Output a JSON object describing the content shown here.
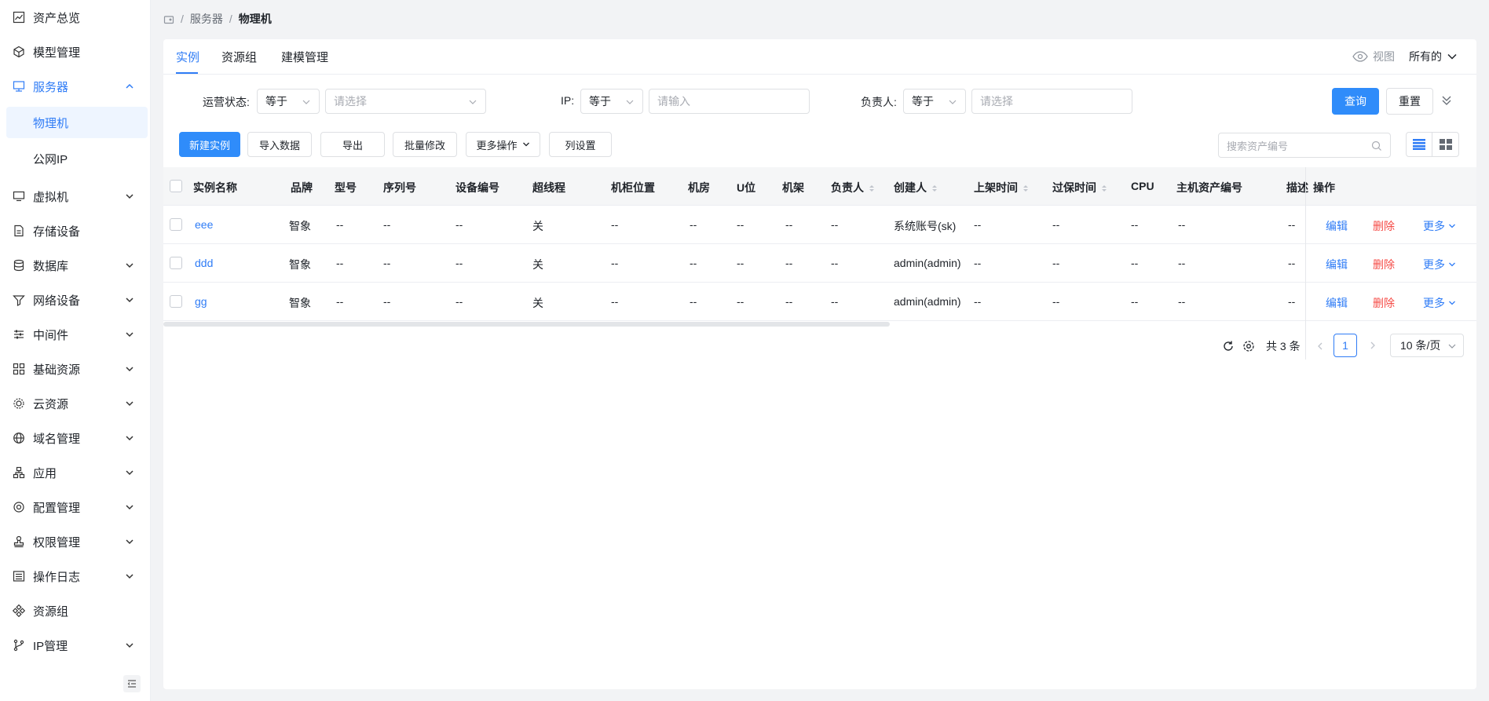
{
  "sidebar": {
    "items": [
      {
        "label": "资产总览",
        "icon": "chart-line-icon"
      },
      {
        "label": "模型管理",
        "icon": "cube-icon"
      },
      {
        "label": "服务器",
        "icon": "monitor-icon"
      },
      {
        "label": "虚拟机",
        "icon": "desktop-icon"
      },
      {
        "label": "存储设备",
        "icon": "file-icon"
      },
      {
        "label": "数据库",
        "icon": "database-icon"
      },
      {
        "label": "网络设备",
        "icon": "funnel-icon"
      },
      {
        "label": "中间件",
        "icon": "sliders-icon"
      },
      {
        "label": "基础资源",
        "icon": "grid-icon"
      },
      {
        "label": "云资源",
        "icon": "gear-cluster-icon"
      },
      {
        "label": "域名管理",
        "icon": "globe-icon"
      },
      {
        "label": "应用",
        "icon": "hierarchy-icon"
      },
      {
        "label": "配置管理",
        "icon": "settings-icon"
      },
      {
        "label": "权限管理",
        "icon": "stamp-icon"
      },
      {
        "label": "操作日志",
        "icon": "list-icon"
      },
      {
        "label": "资源组",
        "icon": "nodes-icon"
      },
      {
        "label": "IP管理",
        "icon": "branch-icon"
      }
    ],
    "sub_items": [
      "物理机",
      "公网IP"
    ]
  },
  "breadcrumb": {
    "level1": "服务器",
    "level2": "物理机"
  },
  "tabs": [
    {
      "label": "实例"
    },
    {
      "label": "资源组"
    },
    {
      "label": "建模管理"
    }
  ],
  "view": {
    "label": "视图",
    "scope": "所有的"
  },
  "filters": {
    "status_label": "运营状态:",
    "status_op": "等于",
    "status_placeholder": "请选择",
    "ip_label": "IP:",
    "ip_op": "等于",
    "ip_placeholder": "请输入",
    "owner_label": "负责人:",
    "owner_op": "等于",
    "owner_placeholder": "请选择",
    "query_label": "查询",
    "reset_label": "重置"
  },
  "toolbar": {
    "create": "新建实例",
    "import": "导入数据",
    "export": "导出",
    "batch_edit": "批量修改",
    "more": "更多操作",
    "column_set": "列设置",
    "search_placeholder": "搜索资产编号"
  },
  "table": {
    "headers": [
      "实例名称",
      "品牌",
      "型号",
      "序列号",
      "设备编号",
      "超线程",
      "机柜位置",
      "机房",
      "U位",
      "机架",
      "负责人",
      "创建人",
      "上架时间",
      "过保时间",
      "CPU",
      "主机资产编号",
      "描述",
      "操作"
    ],
    "rows": [
      {
        "name": "eee",
        "brand": "智象",
        "c3": "--",
        "c4": "--",
        "c5": "--",
        "ht": "关",
        "c7": "--",
        "c8": "--",
        "c9": "--",
        "c10": "--",
        "owner": "--",
        "creator": "系统账号(sk)",
        "c13": "--",
        "c14": "--",
        "c15": "--",
        "c16": "--",
        "c17": "--"
      },
      {
        "name": "ddd",
        "brand": "智象",
        "c3": "--",
        "c4": "--",
        "c5": "--",
        "ht": "关",
        "c7": "--",
        "c8": "--",
        "c9": "--",
        "c10": "--",
        "owner": "--",
        "creator": "admin(admin)",
        "c13": "--",
        "c14": "--",
        "c15": "--",
        "c16": "--",
        "c17": "--"
      },
      {
        "name": "gg",
        "brand": "智象",
        "c3": "--",
        "c4": "--",
        "c5": "--",
        "ht": "关",
        "c7": "--",
        "c8": "--",
        "c9": "--",
        "c10": "--",
        "owner": "--",
        "creator": "admin(admin)",
        "c13": "--",
        "c14": "--",
        "c15": "--",
        "c16": "--",
        "c17": "--"
      }
    ],
    "actions": {
      "edit": "编辑",
      "delete": "删除",
      "more": "更多"
    }
  },
  "pagination": {
    "total": "共 3 条",
    "current": "1",
    "page_size": "10 条/页"
  },
  "colors": {
    "accent": "#2f7cf6",
    "danger": "#f54a45"
  }
}
